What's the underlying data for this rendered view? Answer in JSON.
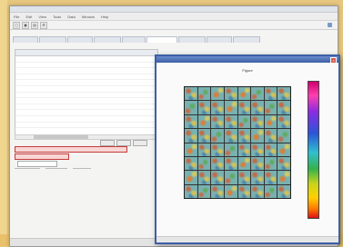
{
  "colors": {
    "background": "#e7c77e",
    "window_border": "#3d5fa6",
    "error_field": "#c43a3a"
  },
  "app": {
    "menu": [
      "File",
      "Edit",
      "View",
      "Tools",
      "Data",
      "Window",
      "Help"
    ],
    "toolbar_icons": [
      "open-icon",
      "save-icon",
      "print-icon",
      "settings-icon"
    ],
    "breadcrumb": "",
    "tabs": [
      "",
      "",
      "",
      "",
      "",
      "",
      "",
      "",
      ""
    ],
    "table": {
      "headers": [
        "",
        "",
        ""
      ],
      "rows": [
        [
          "",
          "",
          ""
        ],
        [
          "",
          "",
          ""
        ],
        [
          "",
          "",
          ""
        ],
        [
          "",
          "",
          ""
        ],
        [
          "",
          "",
          ""
        ],
        [
          "",
          "",
          ""
        ],
        [
          "",
          "",
          ""
        ],
        [
          "",
          "",
          ""
        ],
        [
          "",
          "",
          ""
        ],
        [
          "",
          "",
          ""
        ],
        [
          "",
          "",
          ""
        ],
        [
          "",
          "",
          ""
        ]
      ]
    },
    "buttons": [
      "",
      "",
      ""
    ],
    "form": {
      "error_line_1": "",
      "error_line_2": "",
      "label": "",
      "value": ""
    }
  },
  "heatmap_window": {
    "title": "Figure",
    "subtitle": "",
    "y_ticks": [
      "",
      "",
      "",
      "",
      "",
      "",
      "",
      ""
    ],
    "x_ticks": [
      "",
      "",
      "",
      "",
      "",
      "",
      "",
      ""
    ],
    "colorbar_ticks": [
      "",
      "",
      "",
      "",
      "",
      "",
      "",
      ""
    ],
    "status": ""
  }
}
